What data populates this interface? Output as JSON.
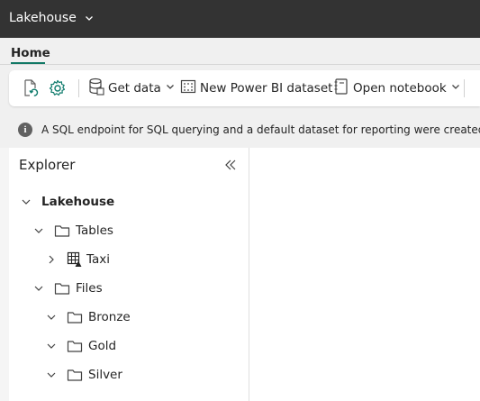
{
  "app": {
    "title": "Lakehouse"
  },
  "tabs": [
    {
      "label": "Home",
      "active": true
    }
  ],
  "toolbar": {
    "get_data": "Get data",
    "new_dataset": "New Power BI dataset",
    "open_notebook": "Open notebook"
  },
  "banner": {
    "message": "A SQL endpoint for SQL querying and a default dataset for reporting were created and will be"
  },
  "explorer": {
    "title": "Explorer",
    "tree": {
      "root": "Lakehouse",
      "tables": {
        "label": "Tables",
        "items": [
          "Taxi"
        ]
      },
      "files": {
        "label": "Files",
        "items": [
          "Bronze",
          "Gold",
          "Silver"
        ]
      }
    }
  },
  "colors": {
    "topbar": "#333333",
    "accent": "#117865",
    "icon_teal": "#0f7b6c"
  }
}
